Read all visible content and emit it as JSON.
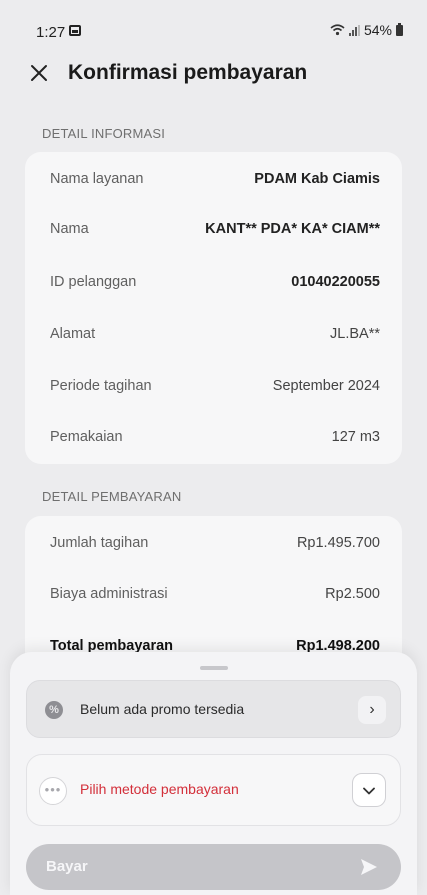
{
  "status_bar": {
    "time": "1:27",
    "battery": "54%"
  },
  "header": {
    "title": "Konfirmasi pembayaran"
  },
  "detail_informasi": {
    "section_label": "DETAIL INFORMASI",
    "rows": [
      {
        "label": "Nama layanan",
        "value": "PDAM Kab Ciamis"
      },
      {
        "label": "Nama",
        "value": "KANT** PDA* KA* CIAM**"
      },
      {
        "label": "ID pelanggan",
        "value": "01040220055"
      },
      {
        "label": "Alamat",
        "value": "JL.BA**"
      },
      {
        "label": "Periode tagihan",
        "value": "September 2024"
      },
      {
        "label": "Pemakaian",
        "value": "127 m3"
      }
    ]
  },
  "detail_pembayaran": {
    "section_label": "DETAIL PEMBAYARAN",
    "rows": [
      {
        "label": "Jumlah tagihan",
        "value": "Rp1.495.700"
      },
      {
        "label": "Biaya administrasi",
        "value": "Rp2.500"
      },
      {
        "label": "Total pembayaran",
        "value": "Rp1.498.200"
      }
    ]
  },
  "bottom_sheet": {
    "promo_text": "Belum ada promo tersedia",
    "method_text": "Pilih metode pembayaran",
    "pay_label": "Bayar"
  },
  "colors": {
    "accent_error": "#d32f3a",
    "button_disabled": "#c5c5c9"
  },
  "icons": [
    "close-icon",
    "promo-icon",
    "chevron-right-icon",
    "more-dots-icon",
    "chevron-down-icon",
    "send-arrow-icon"
  ]
}
